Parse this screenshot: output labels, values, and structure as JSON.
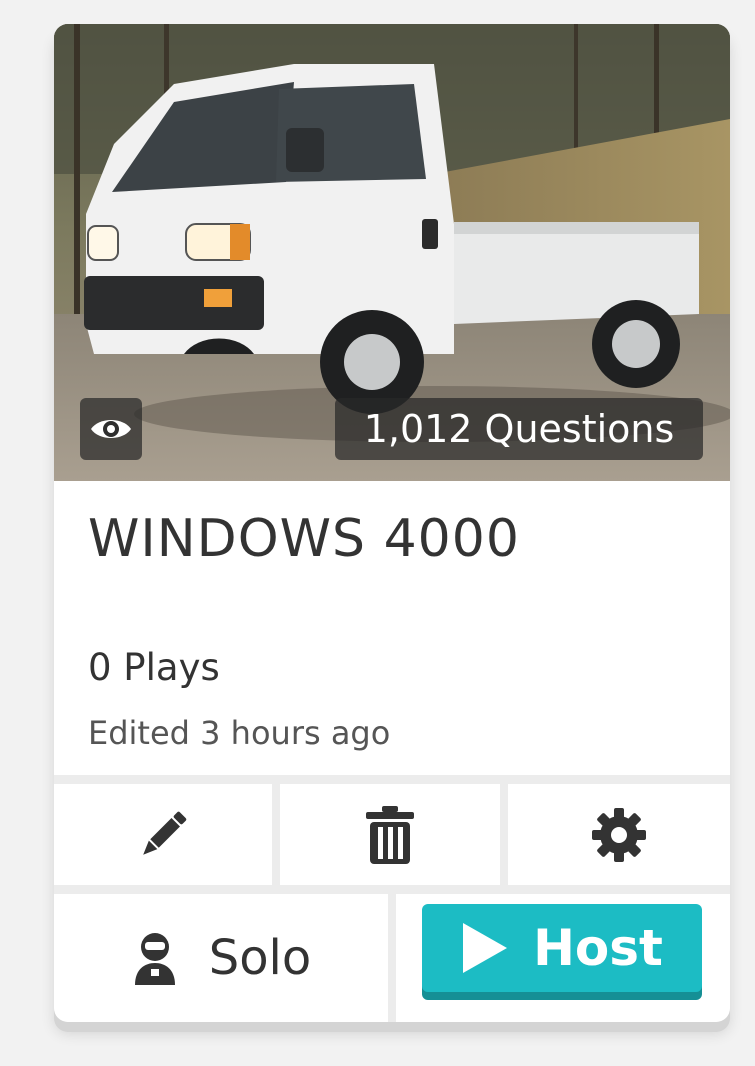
{
  "card": {
    "questions_badge": "1,012 Questions",
    "title": "WINDOWS 4000",
    "plays": "0 Plays",
    "edited": "Edited 3 hours ago"
  },
  "actions": {
    "edit_icon": "pencil-icon",
    "delete_icon": "trash-icon",
    "settings_icon": "gear-icon",
    "preview_icon": "eye-icon"
  },
  "buttons": {
    "solo_label": "Solo",
    "host_label": "Host",
    "host_color": "#1cbcc4"
  }
}
